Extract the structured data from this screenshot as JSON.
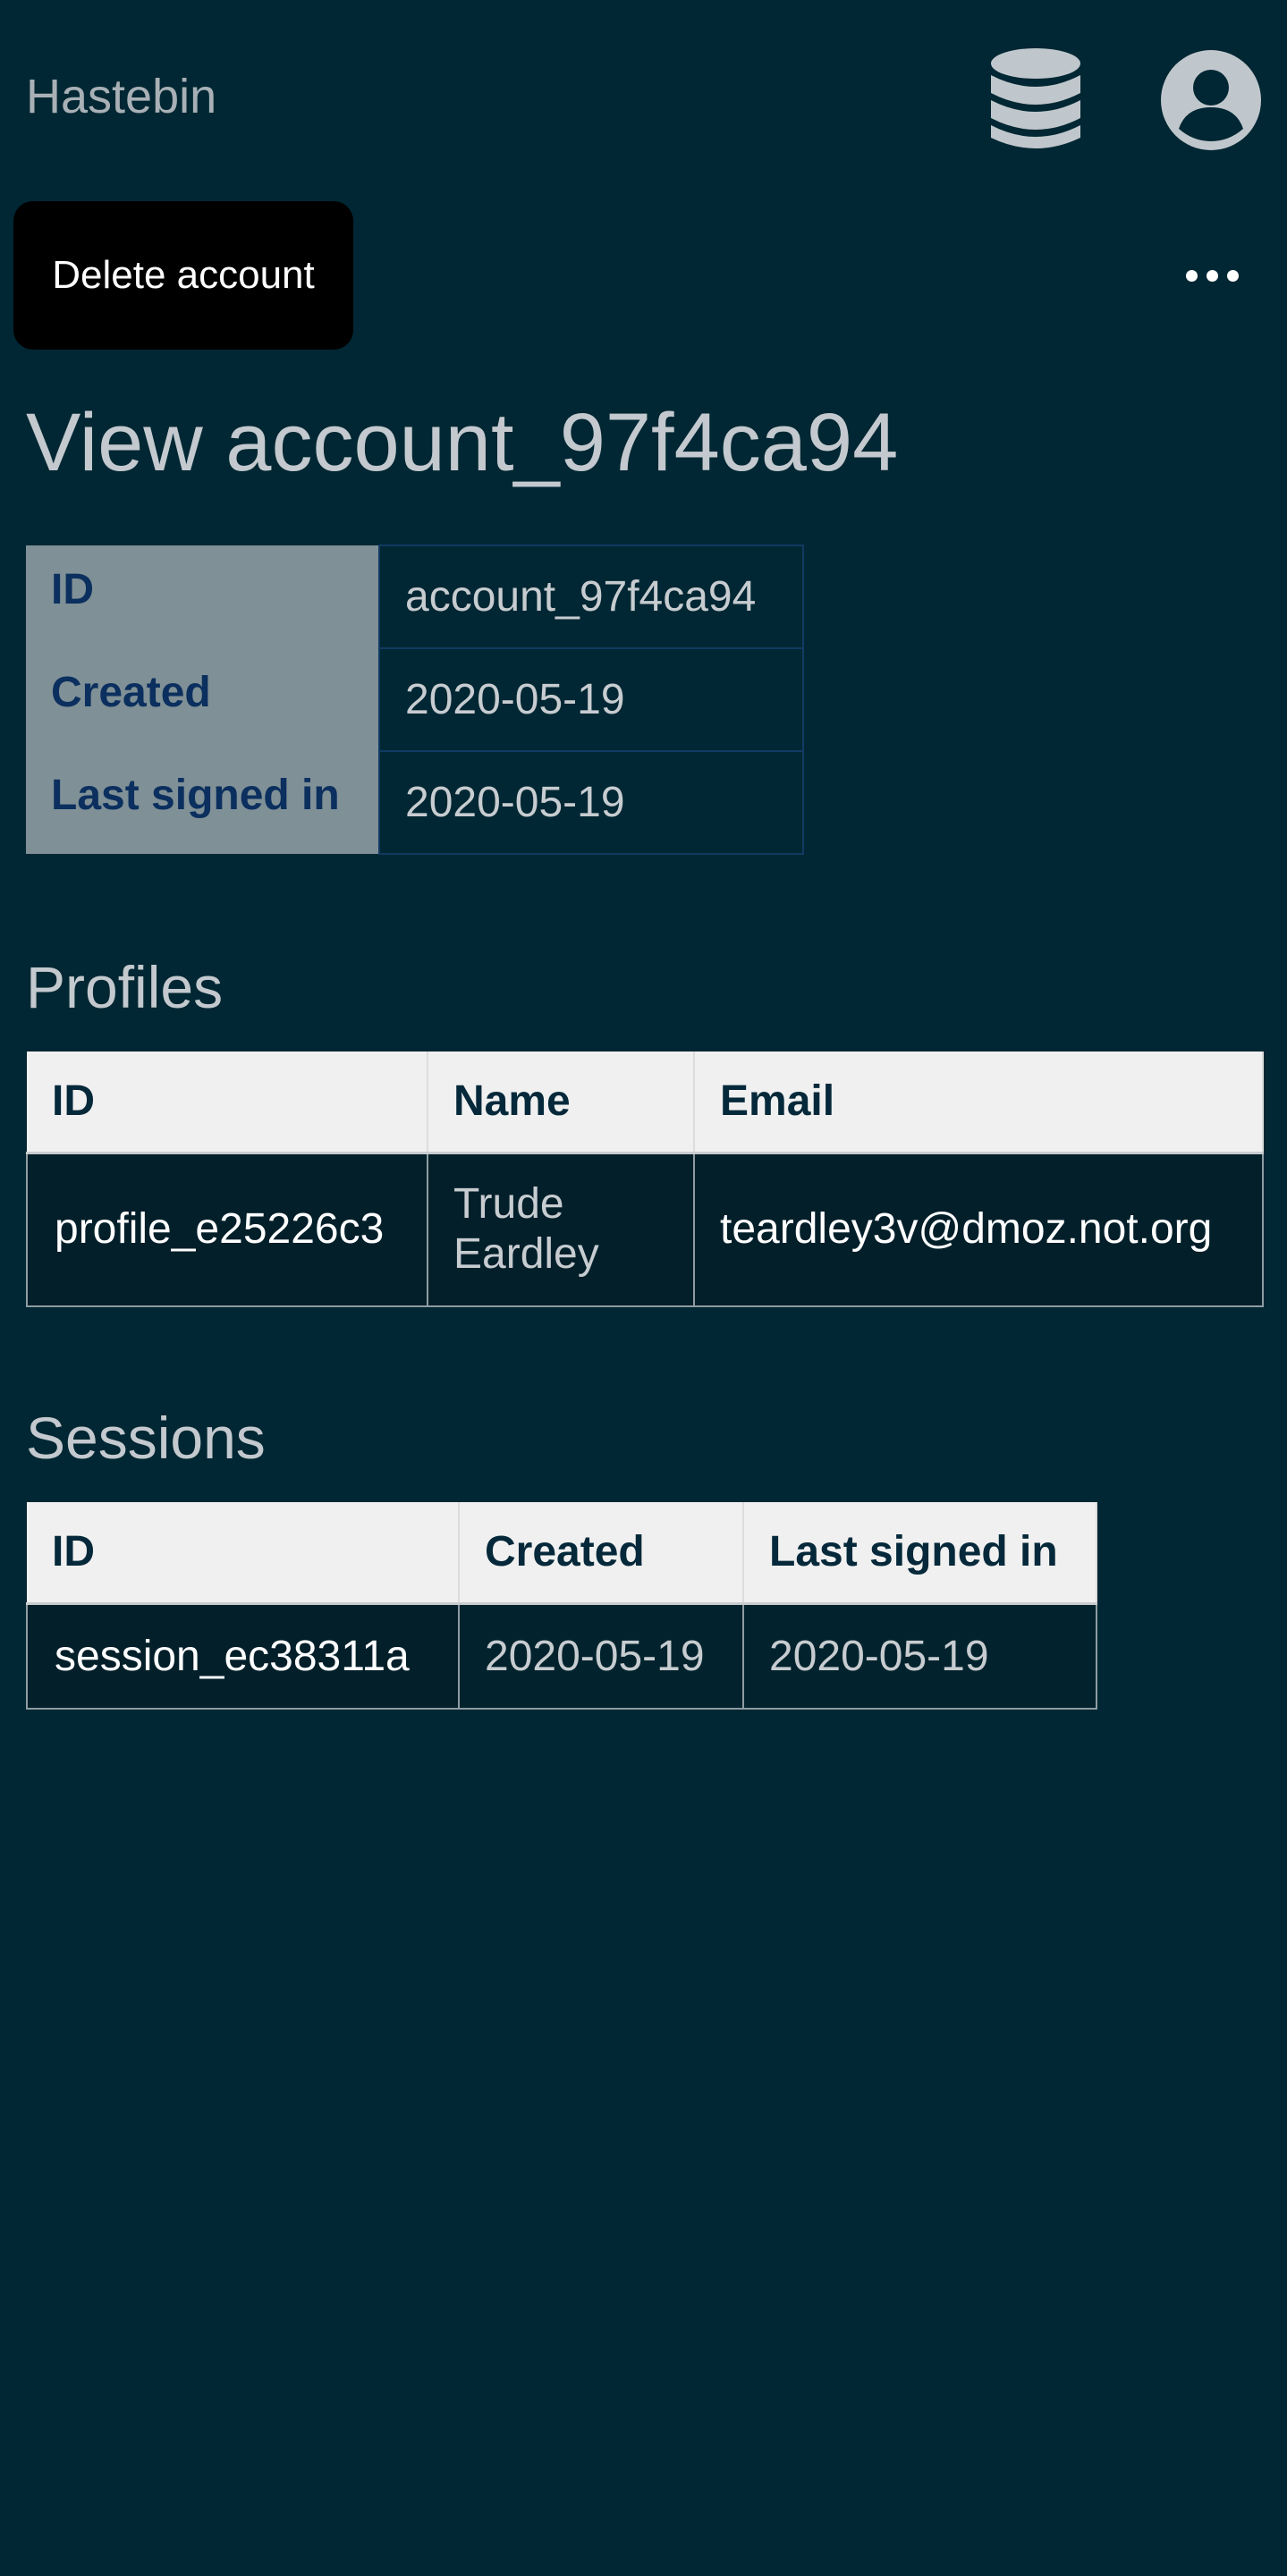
{
  "header": {
    "brand": "Hastebin",
    "icons": {
      "database": "database-icon",
      "account": "user-circle-icon"
    }
  },
  "toolbar": {
    "delete_label": "Delete account",
    "more_icon": "more-horizontal-icon"
  },
  "page_title": "View account_97f4ca94",
  "account": {
    "rows": [
      {
        "label": "ID",
        "value": "account_97f4ca94"
      },
      {
        "label": "Created",
        "value": "2020-05-19"
      },
      {
        "label": "Last signed in",
        "value": "2020-05-19"
      }
    ]
  },
  "profiles": {
    "title": "Profiles",
    "columns": [
      "ID",
      "Name",
      "Email"
    ],
    "rows": [
      {
        "id": "profile_e25226c3",
        "name": "Trude Eardley",
        "email": "teardley3v@dmoz.not.org"
      }
    ]
  },
  "sessions": {
    "title": "Sessions",
    "columns": [
      "ID",
      "Created",
      "Last signed in"
    ],
    "rows": [
      {
        "id": "session_ec38311a",
        "created": "2020-05-19",
        "last_signed_in": "2020-05-19"
      }
    ]
  },
  "colors": {
    "background": "#002733",
    "header_cell": "#f0f0f0",
    "detail_label_bg": "#7f9096",
    "detail_label_text": "#0b2f5e",
    "button": "#000000"
  }
}
